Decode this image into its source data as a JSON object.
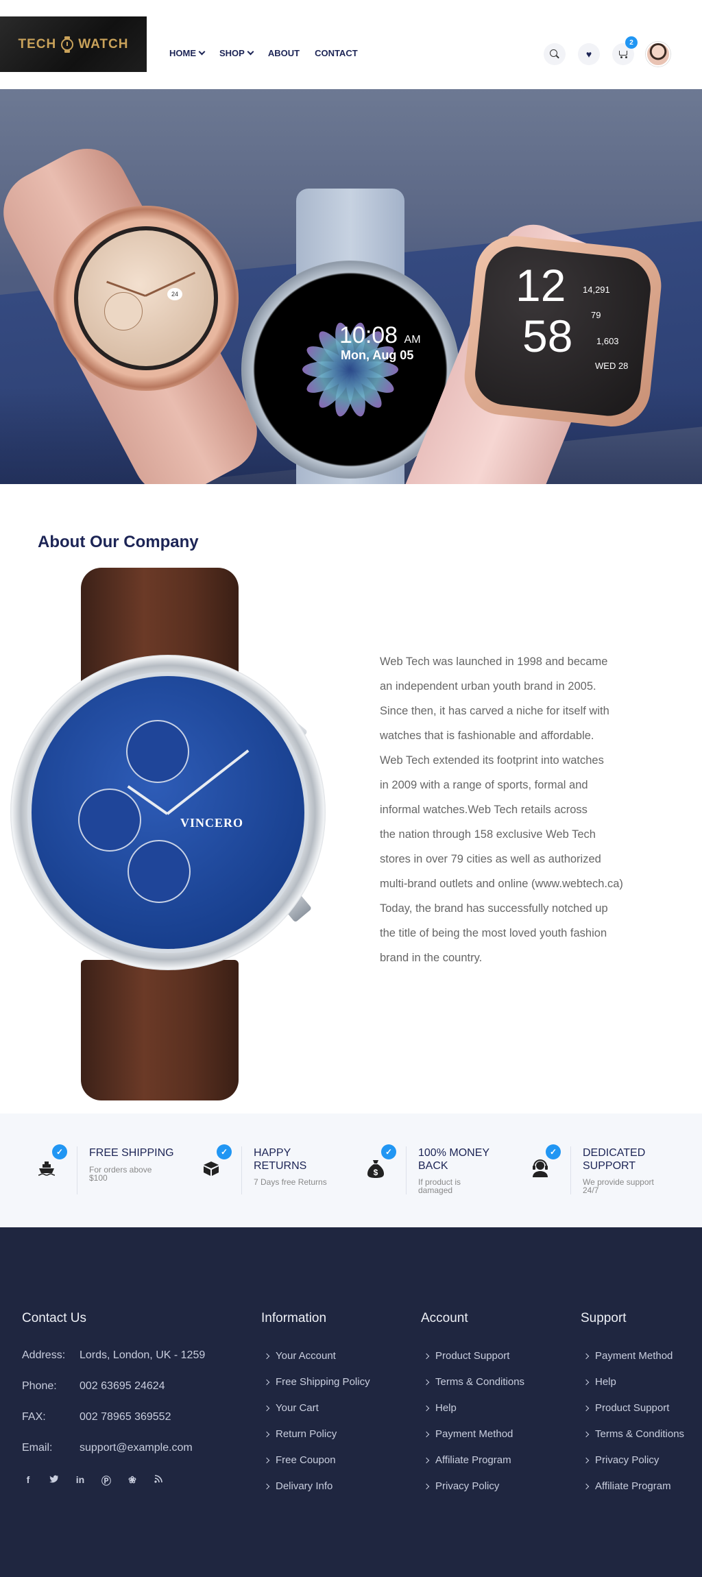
{
  "brand": {
    "logo_text_left": "TECH",
    "logo_text_right": "WATCH",
    "accent_color": "#c9a25a"
  },
  "nav": {
    "items": [
      {
        "label": "HOME",
        "dropdown": true
      },
      {
        "label": "SHOP",
        "dropdown": true
      },
      {
        "label": "ABOUT",
        "dropdown": false
      },
      {
        "label": "CONTACT",
        "dropdown": false
      }
    ]
  },
  "header_actions": {
    "icons": [
      "search-icon",
      "heart-icon",
      "cart-icon",
      "avatar"
    ],
    "cart_count": "2"
  },
  "hero": {
    "watch_round": {
      "time": "10:08",
      "ampm": "AM",
      "date": "Mon, Aug 05"
    },
    "watch_square": {
      "hour": "12",
      "minute": "58",
      "steps": "14,291",
      "heart_rate": "79",
      "calories": "1,603",
      "day": "WED 28"
    },
    "watch_classic": {
      "date_window": "24"
    }
  },
  "about": {
    "title": "About Our Company",
    "watch_brand": "VINCERO",
    "lines": [
      "Web Tech was launched in 1998 and became",
      " an independent urban youth brand in 2005.",
      "Since then, it has carved a niche for itself with",
      " watches that is fashionable and affordable.",
      " Web Tech extended its footprint into watches",
      " in 2009 with a range of sports, formal and",
      " informal watches.Web Tech retails across",
      " the nation through 158 exclusive Web Tech",
      " stores in over 79 cities as well as authorized",
      " multi-brand outlets and online (www.webtech.ca)",
      " Today, the brand has successfully notched up",
      " the title of being the most loved youth fashion",
      " brand in the country."
    ]
  },
  "features": [
    {
      "icon": "ship-icon",
      "title": "FREE SHIPPING",
      "subtitle": "For orders above $100"
    },
    {
      "icon": "box-icon",
      "title": "HAPPY RETURNS",
      "subtitle": "7 Days free Returns"
    },
    {
      "icon": "money-bag-icon",
      "title": "100% MONEY BACK",
      "subtitle": "If product is damaged"
    },
    {
      "icon": "support-icon",
      "title": "DEDICATED SUPPORT",
      "subtitle": "We provide support 24/7"
    }
  ],
  "footer": {
    "contact": {
      "heading": "Contact Us",
      "rows": [
        {
          "label": "Address:",
          "value": "Lords, London, UK - 1259"
        },
        {
          "label": "Phone:",
          "value": "002 63695 24624"
        },
        {
          "label": "FAX:",
          "value": "002 78965 369552"
        },
        {
          "label": "Email:",
          "value": "support@example.com"
        }
      ],
      "social": [
        "facebook-icon",
        "twitter-icon",
        "linkedin-icon",
        "pinterest-icon",
        "dribbble-icon",
        "rss-icon"
      ]
    },
    "information": {
      "heading": "Information",
      "links": [
        "Your Account",
        "Free Shipping Policy",
        "Your Cart",
        "Return Policy",
        "Free Coupon",
        "Delivary Info"
      ]
    },
    "account": {
      "heading": "Account",
      "links": [
        "Product Support",
        "Terms & Conditions",
        "Help",
        "Payment Method",
        "Affiliate Program",
        "Privacy Policy"
      ]
    },
    "support": {
      "heading": "Support",
      "links": [
        "Payment Method",
        "Help",
        "Product Support",
        "Terms & Conditions",
        "Privacy Policy",
        "Affiliate Program"
      ]
    }
  }
}
